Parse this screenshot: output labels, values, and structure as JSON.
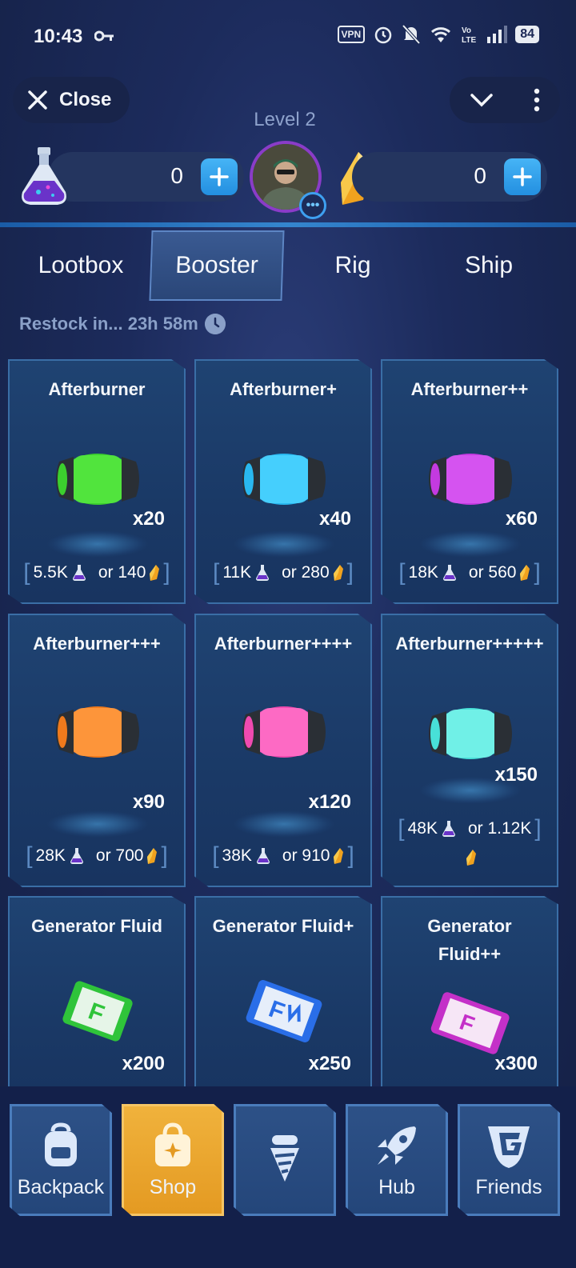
{
  "status_bar": {
    "time": "10:43",
    "vpn": "VPN",
    "battery": "84"
  },
  "header": {
    "close_label": "Close",
    "level": "Level 2",
    "potion_balance": "0",
    "crystal_balance": "0"
  },
  "tabs": [
    {
      "label": "Lootbox",
      "active": false
    },
    {
      "label": "Booster",
      "active": true
    },
    {
      "label": "Rig",
      "active": false
    },
    {
      "label": "Ship",
      "active": false
    }
  ],
  "restock": "Restock in... 23h 58m",
  "items": [
    {
      "name": "Afterburner",
      "qty": "x20",
      "potion_price": "5.5K",
      "crystal_price": "or 140",
      "color": "#3ccf2e"
    },
    {
      "name": "Afterburner+",
      "qty": "x40",
      "potion_price": "11K",
      "crystal_price": "or 280",
      "color": "#29b8f0"
    },
    {
      "name": "Afterburner++",
      "qty": "x60",
      "potion_price": "18K",
      "crystal_price": "or 560",
      "color": "#c43ae0"
    },
    {
      "name": "Afterburner+++",
      "qty": "x90",
      "potion_price": "28K",
      "crystal_price": "or 700",
      "color": "#f07a1c"
    },
    {
      "name": "Afterburner++++",
      "qty": "x120",
      "potion_price": "38K",
      "crystal_price": "or 910",
      "color": "#f04ab0"
    },
    {
      "name": "Afterburner+++++",
      "qty": "x150",
      "potion_price": "48K",
      "crystal_price": "or 1.12K",
      "color": "#48e0d8"
    },
    {
      "name": "Generator Fluid",
      "qty": "x200",
      "color": "#2fc43a"
    },
    {
      "name": "Generator Fluid+",
      "qty": "x250",
      "color": "#2a6ee8"
    },
    {
      "name_line1": "Generator",
      "name_line2": "Fluid++",
      "qty": "x300",
      "color": "#c430c8"
    }
  ],
  "nav": [
    {
      "label": "Backpack",
      "icon": "backpack-icon",
      "active": false
    },
    {
      "label": "Shop",
      "icon": "shop-bag-icon",
      "active": true
    },
    {
      "label": "",
      "icon": "drill-icon",
      "active": false
    },
    {
      "label": "Hub",
      "icon": "rocket-icon",
      "active": false
    },
    {
      "label": "Friends",
      "icon": "friends-logo-icon",
      "active": false
    }
  ]
}
